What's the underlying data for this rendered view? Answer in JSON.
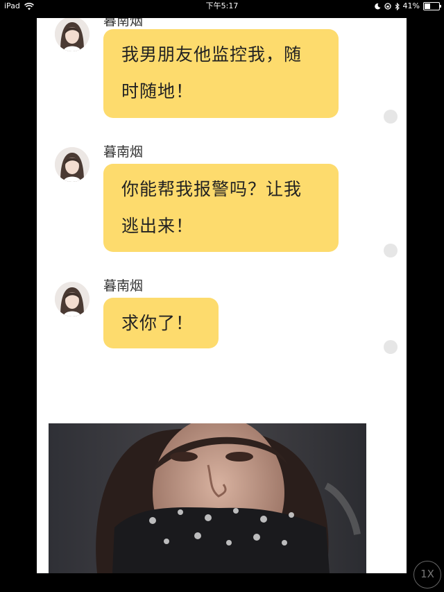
{
  "status_bar": {
    "device": "iPad",
    "time": "下午5:17",
    "battery": "41%",
    "battery_level": 0.41
  },
  "messages": [
    {
      "sender": "暮南烟",
      "lines": [
        "我男朋友他监控我，随",
        "时随地！"
      ]
    },
    {
      "sender": "暮南烟",
      "lines": [
        "你能帮我报警吗？让我",
        "逃出来！"
      ]
    },
    {
      "sender": "暮南烟",
      "lines": [
        "求你了！"
      ]
    }
  ],
  "photo": {
    "icon": "crying-gagged-woman-photo"
  },
  "playback": {
    "speed_label": "1X"
  },
  "colors": {
    "bubble": "#fddb6d",
    "panel": "#ffffff",
    "background": "#000000",
    "read_dot": "#e6e6e6"
  }
}
